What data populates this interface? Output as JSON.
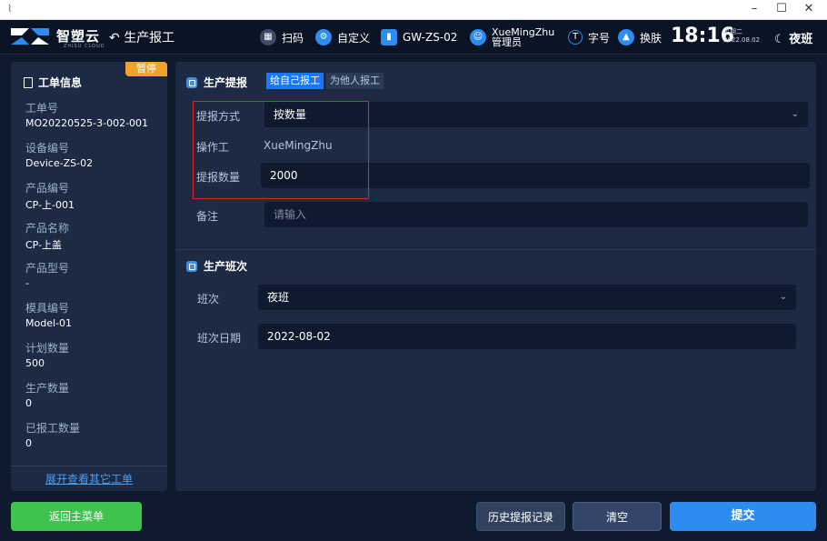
{
  "header": {
    "brand": "智塑云",
    "brand_sub": "ZHISU CLOUD",
    "page_title": "生产报工",
    "scan_label": "扫码",
    "custom_label": "自定义",
    "station": "GW-ZS-02",
    "user_name": "XueMingZhu",
    "user_role": "管理员",
    "font_label": "字号",
    "skin_label": "换肤",
    "time": "18:16",
    "weekday": "星期二",
    "date": "2022.08.02",
    "shift_mode": "夜班"
  },
  "work_order": {
    "status": "暂停",
    "title": "工单信息",
    "fields": [
      {
        "label": "工单号",
        "value": "MO20220525-3-002-001"
      },
      {
        "label": "设备编号",
        "value": "Device-ZS-02"
      },
      {
        "label": "产品编号",
        "value": "CP-上-001"
      },
      {
        "label": "产品名称",
        "value": "CP-上盖"
      },
      {
        "label": "产品型号",
        "value": "-"
      },
      {
        "label": "模具编号",
        "value": "Model-01"
      },
      {
        "label": "计划数量",
        "value": "500"
      },
      {
        "label": "生产数量",
        "value": "0"
      },
      {
        "label": "已报工数量",
        "value": "0"
      }
    ],
    "more_link": "展开查看其它工单"
  },
  "report": {
    "title": "生产提报",
    "tab_self": "给自己报工",
    "tab_others": "为他人报工",
    "method_label": "提报方式",
    "method_value": "按数量",
    "operator_label": "操作工",
    "operator_value": "XueMingZhu",
    "quantity_label": "提报数量",
    "quantity_value": "2000",
    "remark_label": "备注",
    "remark_placeholder": "请输入"
  },
  "shift": {
    "title": "生产班次",
    "shift_label": "班次",
    "shift_value": "夜班",
    "date_label": "班次日期",
    "date_value": "2022-08-02"
  },
  "buttons": {
    "back": "返回主菜单",
    "history": "历史提报记录",
    "clear": "清空",
    "submit": "提交"
  },
  "colors": {
    "accent": "#2d8cf0",
    "status": "#f0a32b",
    "success": "#3fc34f",
    "highlight": "#e02323"
  }
}
